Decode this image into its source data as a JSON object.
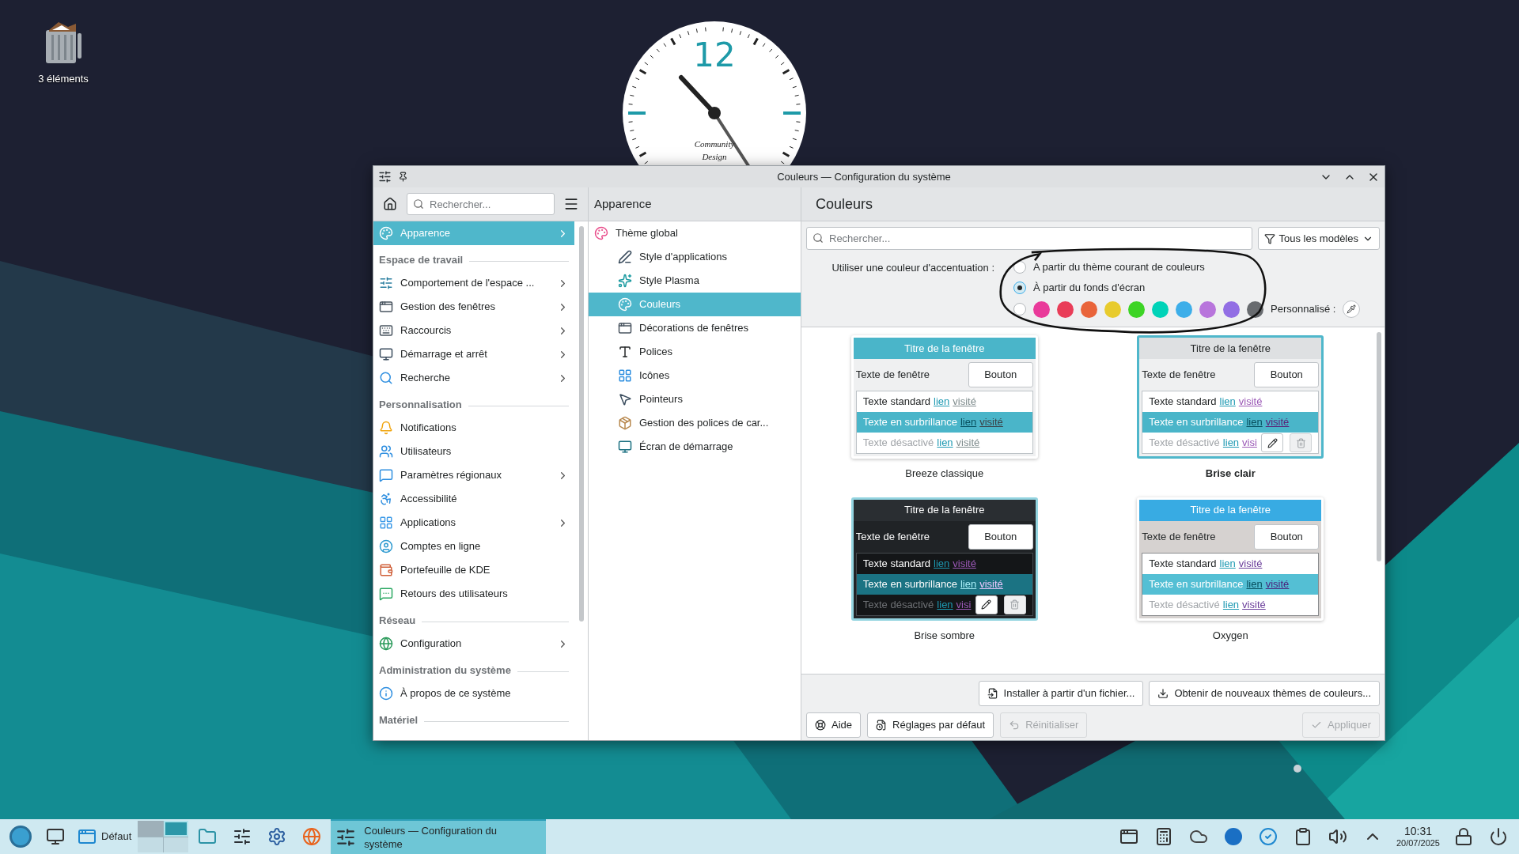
{
  "desktop": {
    "icon_label": "3 éléments",
    "clock": {
      "numeral": "12",
      "caption": [
        "Community",
        "Design"
      ]
    }
  },
  "window": {
    "title": "Couleurs — Configuration du système"
  },
  "sidebar": {
    "search_placeholder": "Rechercher...",
    "entries": [
      {
        "kind": "item",
        "label": "Apparence",
        "selected": true,
        "submenu": true
      },
      {
        "kind": "heading",
        "label": "Espace de travail"
      },
      {
        "kind": "item",
        "label": "Comportement de l'espace ...",
        "selected": false,
        "submenu": true
      },
      {
        "kind": "item",
        "label": "Gestion des fenêtres",
        "selected": false,
        "submenu": true
      },
      {
        "kind": "item",
        "label": "Raccourcis",
        "selected": false,
        "submenu": true
      },
      {
        "kind": "item",
        "label": "Démarrage et arrêt",
        "selected": false,
        "submenu": true
      },
      {
        "kind": "item",
        "label": "Recherche",
        "selected": false,
        "submenu": true
      },
      {
        "kind": "heading",
        "label": "Personnalisation"
      },
      {
        "kind": "item",
        "label": "Notifications",
        "selected": false,
        "submenu": false
      },
      {
        "kind": "item",
        "label": "Utilisateurs",
        "selected": false,
        "submenu": false
      },
      {
        "kind": "item",
        "label": "Paramètres régionaux",
        "selected": false,
        "submenu": true
      },
      {
        "kind": "item",
        "label": "Accessibilité",
        "selected": false,
        "submenu": false
      },
      {
        "kind": "item",
        "label": "Applications",
        "selected": false,
        "submenu": true
      },
      {
        "kind": "item",
        "label": "Comptes en ligne",
        "selected": false,
        "submenu": false
      },
      {
        "kind": "item",
        "label": "Portefeuille de KDE",
        "selected": false,
        "submenu": false
      },
      {
        "kind": "item",
        "label": "Retours des utilisateurs",
        "selected": false,
        "submenu": false
      },
      {
        "kind": "heading",
        "label": "Réseau"
      },
      {
        "kind": "item",
        "label": "Configuration",
        "selected": false,
        "submenu": true
      },
      {
        "kind": "heading",
        "label": "Administration du système"
      },
      {
        "kind": "item",
        "label": "À propos de ce système",
        "selected": false,
        "submenu": false
      },
      {
        "kind": "heading",
        "label": "Matériel"
      }
    ]
  },
  "category": {
    "title": "Apparence",
    "items": [
      {
        "label": "Thème global",
        "selected": false,
        "children": [
          {
            "label": "Style d'applications",
            "selected": false
          },
          {
            "label": "Style Plasma",
            "selected": false
          },
          {
            "label": "Couleurs",
            "selected": true
          },
          {
            "label": "Décorations de fenêtres",
            "selected": false
          },
          {
            "label": "Polices",
            "selected": false
          },
          {
            "label": "Icônes",
            "selected": false
          },
          {
            "label": "Pointeurs",
            "selected": false
          },
          {
            "label": "Gestion des polices de car...",
            "selected": false
          },
          {
            "label": "Écran de démarrage",
            "selected": false
          }
        ]
      }
    ]
  },
  "page": {
    "title": "Couleurs",
    "search_placeholder": "Rechercher...",
    "filter": "Tous les modèles",
    "accent": {
      "label": "Utiliser une couleur d'accentuation :",
      "options": [
        {
          "kind": "text",
          "label": "A partir du thème courant de couleurs",
          "selected": false
        },
        {
          "kind": "text",
          "label": "À partir du fonds d'écran",
          "selected": true
        },
        {
          "kind": "custom",
          "selected": false
        }
      ],
      "swatches": [
        {
          "color": "#e93a9a",
          "selected": false
        },
        {
          "color": "#e93d58",
          "selected": false
        },
        {
          "color": "#e9643a",
          "selected": false
        },
        {
          "color": "#e8cb2d",
          "selected": false
        },
        {
          "color": "#3dd425",
          "selected": false
        },
        {
          "color": "#00d3b8",
          "selected": false
        },
        {
          "color": "#3daee9",
          "selected": false
        },
        {
          "color": "#b875dc",
          "selected": false
        },
        {
          "color": "#926ee4",
          "selected": false
        },
        {
          "color": "#686b6f",
          "selected": false
        }
      ],
      "custom_label": "Personnalisé :"
    },
    "schemes": [
      {
        "name": "Breeze classique",
        "kind": "breeze",
        "selected": false,
        "hovered": false,
        "title": "Titre de la fenêtre",
        "window_text": "Texte de fenêtre",
        "button": "Bouton",
        "rows": [
          {
            "kind": "normal",
            "text": "Texte standard",
            "link": "lien",
            "visited": "visité"
          },
          {
            "kind": "highlight",
            "text": "Texte en surbrillance",
            "link": "lien",
            "visited": "visité"
          },
          {
            "kind": "disabled",
            "text": "Texte désactivé",
            "link": "lien",
            "visited": "visité"
          }
        ]
      },
      {
        "name": "Brise clair",
        "kind": "light",
        "selected": true,
        "hovered": true,
        "title": "Titre de la fenêtre",
        "window_text": "Texte de fenêtre",
        "button": "Bouton",
        "rows": [
          {
            "kind": "normal",
            "text": "Texte standard",
            "link": "lien",
            "visited": "visité"
          },
          {
            "kind": "highlight",
            "text": "Texte en surbrillance",
            "link": "lien",
            "visited": "visité"
          },
          {
            "kind": "disabled",
            "text": "Texte désactivé",
            "link": "lien",
            "visited": "visi"
          }
        ]
      },
      {
        "name": "Brise sombre",
        "kind": "dark",
        "selected": false,
        "hovered": true,
        "title": "Titre de la fenêtre",
        "window_text": "Texte de fenêtre",
        "button": "Bouton",
        "rows": [
          {
            "kind": "normal",
            "text": "Texte standard",
            "link": "lien",
            "visited": "visité"
          },
          {
            "kind": "highlight",
            "text": "Texte en surbrillance",
            "link": "lien",
            "visited": "visité"
          },
          {
            "kind": "disabled",
            "text": "Texte désactivé",
            "link": "lien",
            "visited": "visi"
          }
        ]
      },
      {
        "name": "Oxygen",
        "kind": "oxygen",
        "selected": false,
        "hovered": false,
        "title": "Titre de la fenêtre",
        "window_text": "Texte de fenêtre",
        "button": "Bouton",
        "rows": [
          {
            "kind": "normal",
            "text": "Texte standard",
            "link": "lien",
            "visited": "visité"
          },
          {
            "kind": "highlight",
            "text": "Texte en surbrillance",
            "link": "lien",
            "visited": "visité"
          },
          {
            "kind": "disabled",
            "text": "Texte désactivé",
            "link": "lien",
            "visited": "visité"
          }
        ]
      }
    ],
    "top_buttons": [
      {
        "label": "Installer à partir d'un fichier...",
        "disabled": false
      },
      {
        "label": "Obtenir de nouveaux thèmes de couleurs...",
        "disabled": false
      }
    ],
    "left_buttons": [
      {
        "label": "Aide",
        "disabled": false
      },
      {
        "label": "Réglages par défaut",
        "disabled": false
      },
      {
        "label": "Réinitialiser",
        "disabled": true
      }
    ],
    "right_buttons": [
      {
        "label": "Appliquer",
        "disabled": true
      }
    ]
  },
  "taskbar": {
    "activity": "Défaut",
    "tasks": [
      {
        "label": "Couleurs  — Configuration du système",
        "selected": true
      }
    ],
    "time": "10:31",
    "date": "20/07/2025"
  }
}
